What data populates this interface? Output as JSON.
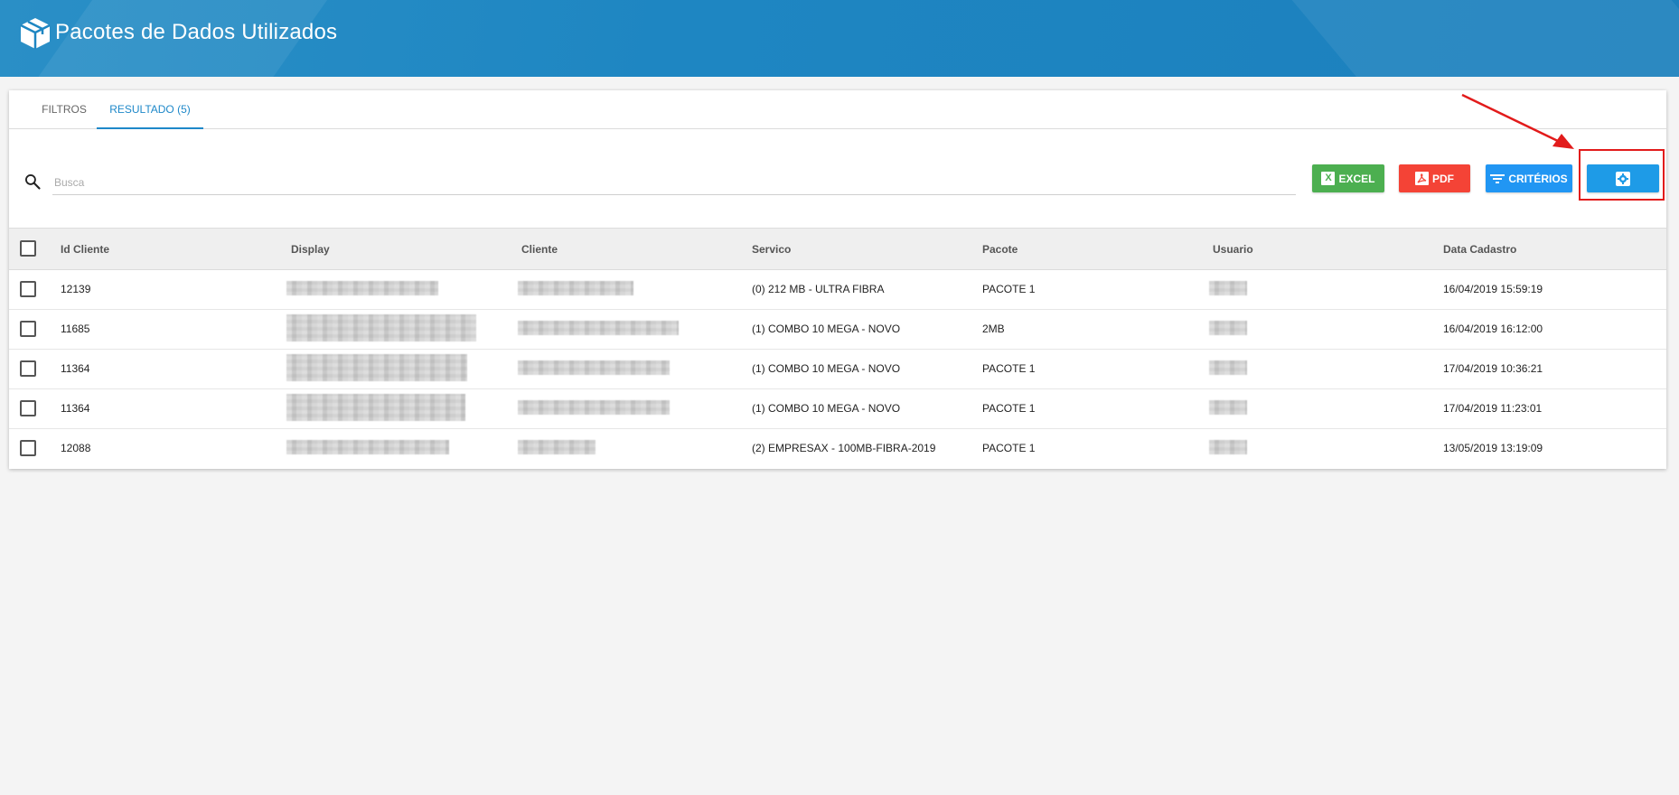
{
  "header": {
    "title": "Pacotes de Dados Utilizados",
    "logo_icon": "box-cube-icon"
  },
  "tabs": [
    {
      "label": "FILTROS",
      "active": false
    },
    {
      "label": "RESULTADO (5)",
      "active": true
    }
  ],
  "search": {
    "placeholder": "Busca",
    "value": ""
  },
  "toolbar": {
    "excel_label": "EXCEL",
    "pdf_label": "PDF",
    "criterios_label": "CRITÉRIOS",
    "settings_icon": "gear-icon"
  },
  "table": {
    "columns": [
      "Id Cliente",
      "Display",
      "Cliente",
      "Servico",
      "Pacote",
      "Usuario",
      "Data Cadastro"
    ],
    "rows": [
      {
        "id": "12139",
        "servico": "(0) 212 MB - ULTRA FIBRA",
        "pacote": "PACOTE 1",
        "data": "16/04/2019 15:59:19"
      },
      {
        "id": "11685",
        "servico": "(1) COMBO 10 MEGA - NOVO",
        "pacote": "2MB",
        "data": "16/04/2019 16:12:00"
      },
      {
        "id": "11364",
        "servico": "(1) COMBO 10 MEGA - NOVO",
        "pacote": "PACOTE 1",
        "data": "17/04/2019 10:36:21"
      },
      {
        "id": "11364",
        "servico": "(1) COMBO 10 MEGA - NOVO",
        "pacote": "PACOTE 1",
        "data": "17/04/2019 11:23:01"
      },
      {
        "id": "12088",
        "servico": "(2) EMPRESAX - 100MB-FIBRA-2019",
        "pacote": "PACOTE 1",
        "data": "13/05/2019 13:19:09"
      }
    ]
  },
  "colors": {
    "header": "#1e86c2",
    "excel": "#4caf50",
    "pdf": "#f44336",
    "criterios": "#2196f3",
    "settings": "#1e9be7",
    "annotation": "#e21b1b"
  }
}
